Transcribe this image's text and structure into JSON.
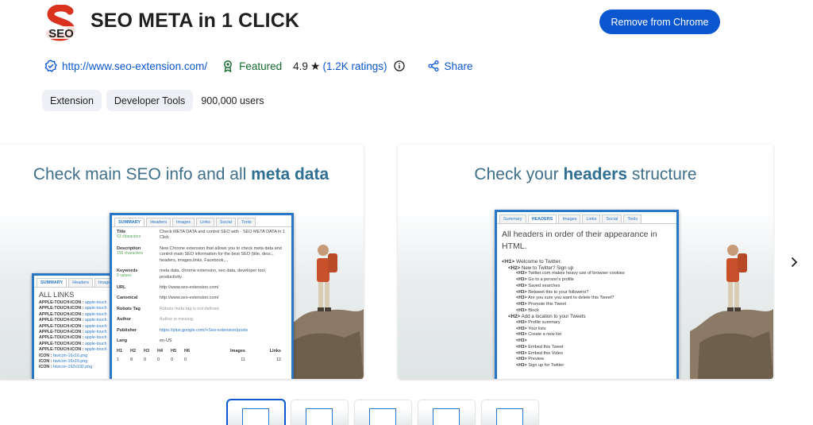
{
  "header": {
    "logo_text": "SEO",
    "title": "SEO META in 1 CLICK",
    "remove_button": "Remove from Chrome"
  },
  "meta": {
    "website": "http://www.seo-extension.com/",
    "featured": "Featured",
    "rating_value": "4.9",
    "ratings_count": "(1.2K ratings)",
    "share": "Share"
  },
  "chips": {
    "items": [
      "Extension",
      "Developer Tools"
    ],
    "users": "900,000 users"
  },
  "slide1": {
    "heading_pre": "Check main SEO info and all",
    "heading_bold": "meta data",
    "summary_tabs": [
      "SUMMARY",
      "Headers",
      "Images",
      "Links",
      "Social",
      "Tools"
    ],
    "fields": [
      {
        "k": "Title",
        "sub": "63 characters",
        "v": "Check META DATA and control SEO with - SEO META DATA in 1 Click"
      },
      {
        "k": "Description",
        "sub": "156 characters",
        "v": "New Chrome extension that allows you to check meta data and control main SEO information for the best SEO (title, desc., headers, images,links, Facebook,..."
      },
      {
        "k": "Keywords",
        "sub": "5 values",
        "v": "meta data, chrome extension, seo data, developer tool, productivity"
      },
      {
        "k": "URL",
        "sub": "",
        "v": "http://www.seo-extension.com/"
      },
      {
        "k": "Canonical",
        "sub": "",
        "v": "http://www.seo-extension.com/"
      },
      {
        "k": "Robots Tag",
        "sub": "",
        "v": "Robots meta tag is not defined."
      },
      {
        "k": "Author",
        "sub": "",
        "v": "Author is missing."
      },
      {
        "k": "Publisher",
        "sub": "",
        "v": "https://plus.google.com/+Seo-extension/posts"
      },
      {
        "k": "Lang",
        "sub": "",
        "v": "en-US"
      }
    ],
    "h_headers": [
      "H1",
      "H2",
      "H3",
      "H4",
      "H5",
      "H6"
    ],
    "h_values": [
      "1",
      "8",
      "0",
      "0",
      "0",
      "0"
    ],
    "images_label": "Images",
    "images_value": "11",
    "links_label": "Links",
    "links_value": "12",
    "links_tabs": [
      "SUMMARY",
      "Headers",
      "Images"
    ],
    "all_links_title": "ALL LINKS",
    "link_lines": [
      {
        "k": "APPLE-TOUCH-ICON :",
        "u": "apple-touch"
      },
      {
        "k": "APPLE-TOUCH-ICON :",
        "u": "apple-touch"
      },
      {
        "k": "APPLE-TOUCH-ICON :",
        "u": "apple-touch"
      },
      {
        "k": "APPLE-TOUCH-ICON :",
        "u": "apple-touch"
      },
      {
        "k": "APPLE-TOUCH-ICON :",
        "u": "apple-touch"
      },
      {
        "k": "APPLE-TOUCH-ICON :",
        "u": "apple-touch"
      },
      {
        "k": "APPLE-TOUCH-ICON :",
        "u": "apple-touch"
      },
      {
        "k": "APPLE-TOUCH-ICON :",
        "u": "apple-touch"
      },
      {
        "k": "APPLE-TOUCH-ICON :",
        "u": "apple-touch"
      },
      {
        "k": "ICON :",
        "u": "favicon-16x16.png"
      },
      {
        "k": "ICON :",
        "u": "favicon-16x16.png"
      },
      {
        "k": "ICON :",
        "u": "favicon-192x192.png"
      }
    ]
  },
  "slide2": {
    "heading_pre": "Check your",
    "heading_bold": "headers",
    "heading_post": "structure",
    "tabs": [
      "Summary",
      "HEADERS",
      "Images",
      "Links",
      "Social",
      "Tools"
    ],
    "intro": "All headers in order of their appearance in HTML.",
    "lines": [
      {
        "lvl": "h1",
        "tag": "<H1>",
        "text": "Welcome to Twitter."
      },
      {
        "lvl": "h2",
        "tag": "<H2>",
        "text": "New to Twitter? Sign up"
      },
      {
        "lvl": "h3",
        "tag": "<H3>",
        "text": "Twitter.com makes heavy use of browser cookies"
      },
      {
        "lvl": "h3",
        "tag": "<H3>",
        "text": "Go to a person's profile"
      },
      {
        "lvl": "h3",
        "tag": "<H3>",
        "text": "Saved searches"
      },
      {
        "lvl": "h3",
        "tag": "<H3>",
        "text": "Retweet this to your followers?"
      },
      {
        "lvl": "h3",
        "tag": "<H3>",
        "text": "Are you sure you want to delete this Tweet?"
      },
      {
        "lvl": "h3",
        "tag": "<H3>",
        "text": "Promote this Tweet"
      },
      {
        "lvl": "h3",
        "tag": "<H3>",
        "text": "Block"
      },
      {
        "lvl": "h2",
        "tag": "<H2>",
        "text": "Add a location to your Tweets"
      },
      {
        "lvl": "h3",
        "tag": "<H3>",
        "text": "Profile summary"
      },
      {
        "lvl": "h3",
        "tag": "<H3>",
        "text": "Your lists"
      },
      {
        "lvl": "h3",
        "tag": "<H3>",
        "text": "Create a new list"
      },
      {
        "lvl": "h3",
        "tag": "<H3>",
        "text": ""
      },
      {
        "lvl": "h3",
        "tag": "<H3>",
        "text": "Embed this Tweet"
      },
      {
        "lvl": "h3",
        "tag": "<H3>",
        "text": "Embed this Video"
      },
      {
        "lvl": "h3",
        "tag": "<H3>",
        "text": "Preview"
      },
      {
        "lvl": "h3",
        "tag": "<H3>",
        "text": "Sign up for Twitter"
      }
    ]
  },
  "thumbnails": {
    "count": 5,
    "active_index": 0
  },
  "colors": {
    "accent": "#0b57d0",
    "featured_green": "#146c2e",
    "logo_red": "#d9321f",
    "panel_border": "#2a77c8"
  }
}
